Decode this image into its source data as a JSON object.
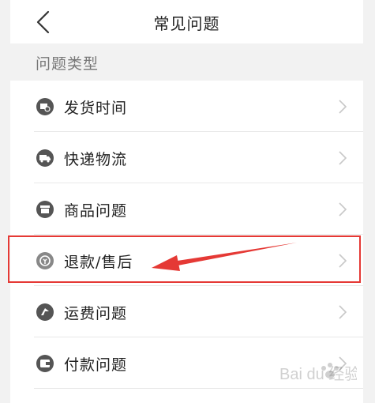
{
  "header": {
    "title": "常见问题"
  },
  "section": {
    "title": "问题类型"
  },
  "items": [
    {
      "label": "发货时间",
      "icon": "shipping-time-icon"
    },
    {
      "label": "快递物流",
      "icon": "delivery-truck-icon"
    },
    {
      "label": "商品问题",
      "icon": "product-box-icon"
    },
    {
      "label": "退款/售后",
      "icon": "refund-icon"
    },
    {
      "label": "运费问题",
      "icon": "freight-icon"
    },
    {
      "label": "付款问题",
      "icon": "wallet-icon"
    }
  ],
  "annotation": {
    "highlight_color": "#e53935"
  },
  "watermark": {
    "text": "Bai du 经验"
  },
  "colors": {
    "icon": "#555555",
    "text": "#222222",
    "section_text": "#777777",
    "divider": "#e8e8e8",
    "chevron": "#c8c8c8"
  }
}
